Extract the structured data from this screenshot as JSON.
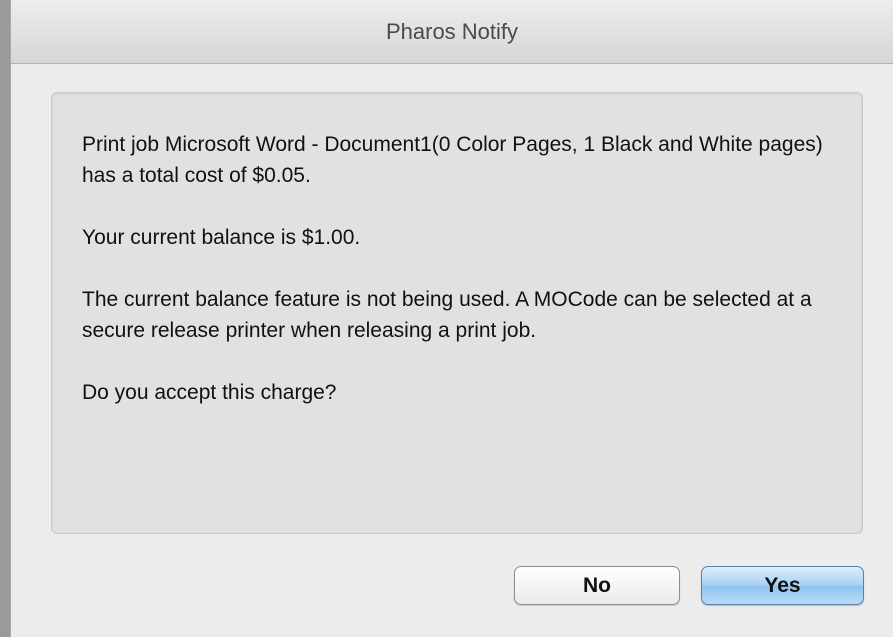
{
  "window": {
    "title": "Pharos Notify"
  },
  "message": {
    "paragraph1": "Print job Microsoft Word - Document1(0 Color Pages, 1 Black and White pages) has a total cost of $0.05.",
    "paragraph2": "Your current balance is $1.00.",
    "paragraph3": "The current balance feature is not being used. A MOCode can be selected at a secure release printer when releasing a print job.",
    "paragraph4": "Do you accept this charge?"
  },
  "buttons": {
    "no_label": "No",
    "yes_label": "Yes"
  },
  "colors": {
    "default_button": "#a7d0f3",
    "window_background": "#ececec",
    "message_panel": "#e1e1e1"
  }
}
